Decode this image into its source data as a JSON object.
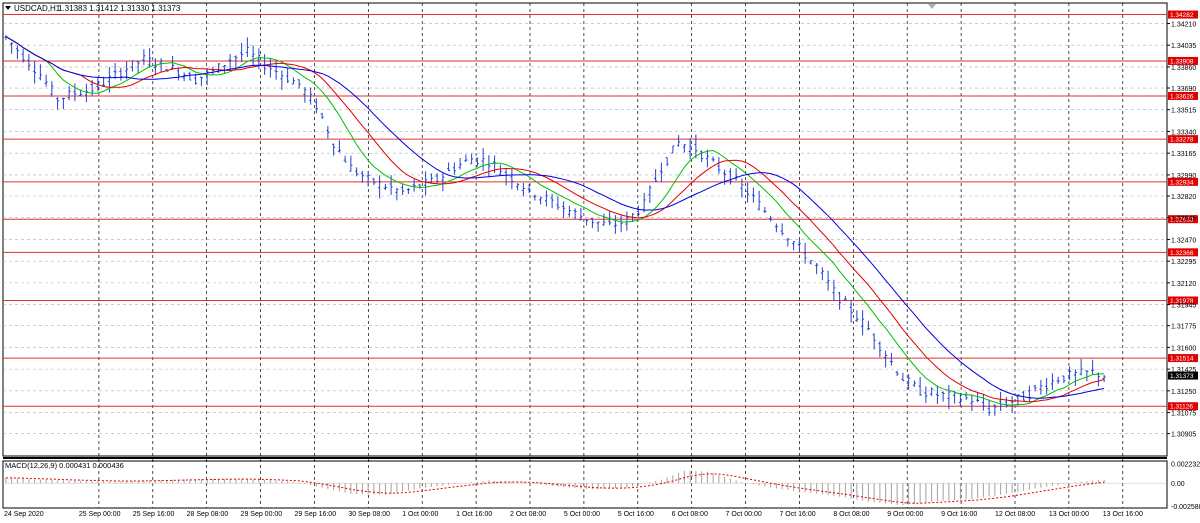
{
  "header": {
    "menu_icon": "triangle-down-icon",
    "symbol": "USDCAD,H1",
    "ohlc": "1.31383 1.31412 1.31330 1.31373"
  },
  "macd_label": "MACD(12,26,9) 0.000431 0.000436",
  "chart_data": [
    {
      "type": "candlestick",
      "title": "USDCAD,H1",
      "ylim": [
        1.30725,
        1.34375
      ],
      "y_ticks": [
        "1.34210",
        "1.34035",
        "1.33860",
        "1.33690",
        "1.33515",
        "1.33340",
        "1.33165",
        "1.32990",
        "1.32820",
        "1.32645",
        "1.32470",
        "1.32295",
        "1.32120",
        "1.31945",
        "1.31775",
        "1.31600",
        "1.31425",
        "1.31250",
        "1.31075",
        "1.30905"
      ],
      "x_ticks": [
        "24 Sep 2020",
        "25 Sep 00:00",
        "25 Sep 16:00",
        "28 Sep 08:00",
        "29 Sep 00:00",
        "29 Sep 16:00",
        "30 Sep 08:00",
        "1 Oct 00:00",
        "1 Oct 16:00",
        "2 Oct 08:00",
        "5 Oct 00:00",
        "5 Oct 16:00",
        "6 Oct 08:00",
        "7 Oct 00:00",
        "7 Oct 16:00",
        "8 Oct 08:00",
        "9 Oct 00:00",
        "9 Oct 16:00",
        "12 Oct 08:00",
        "13 Oct 00:00",
        "13 Oct 16:00"
      ],
      "horizontal_levels": [
        1.34282,
        1.33908,
        1.33626,
        1.33278,
        1.32934,
        1.32633,
        1.32366,
        1.31978,
        1.31514,
        1.31126
      ],
      "current_price": 1.31373,
      "close_path": [
        [
          0,
          1.341
        ],
        [
          3,
          1.3395
        ],
        [
          6,
          1.338
        ],
        [
          9,
          1.336
        ],
        [
          12,
          1.3365
        ],
        [
          15,
          1.3368
        ],
        [
          18,
          1.3376
        ],
        [
          21,
          1.3385
        ],
        [
          24,
          1.3392
        ],
        [
          27,
          1.3388
        ],
        [
          30,
          1.3383
        ],
        [
          33,
          1.3376
        ],
        [
          36,
          1.3382
        ],
        [
          39,
          1.3392
        ],
        [
          42,
          1.3398
        ],
        [
          45,
          1.3388
        ],
        [
          48,
          1.338
        ],
        [
          51,
          1.3372
        ],
        [
          54,
          1.3355
        ],
        [
          57,
          1.3325
        ],
        [
          60,
          1.3305
        ],
        [
          63,
          1.3295
        ],
        [
          66,
          1.329
        ],
        [
          69,
          1.3285
        ],
        [
          72,
          1.329
        ],
        [
          75,
          1.3295
        ],
        [
          78,
          1.3305
        ],
        [
          81,
          1.3312
        ],
        [
          84,
          1.331
        ],
        [
          87,
          1.33
        ],
        [
          90,
          1.329
        ],
        [
          93,
          1.3282
        ],
        [
          96,
          1.3275
        ],
        [
          99,
          1.3268
        ],
        [
          102,
          1.3262
        ],
        [
          105,
          1.3258
        ],
        [
          108,
          1.3262
        ],
        [
          111,
          1.3275
        ],
        [
          114,
          1.3305
        ],
        [
          117,
          1.3325
        ],
        [
          120,
          1.332
        ],
        [
          123,
          1.3308
        ],
        [
          126,
          1.3298
        ],
        [
          129,
          1.3285
        ],
        [
          132,
          1.327
        ],
        [
          135,
          1.3255
        ],
        [
          138,
          1.324
        ],
        [
          141,
          1.3225
        ],
        [
          144,
          1.3205
        ],
        [
          147,
          1.319
        ],
        [
          150,
          1.3175
        ],
        [
          153,
          1.3155
        ],
        [
          156,
          1.3135
        ],
        [
          159,
          1.3125
        ],
        [
          162,
          1.3122
        ],
        [
          165,
          1.312
        ],
        [
          168,
          1.3118
        ],
        [
          171,
          1.311
        ],
        [
          174,
          1.3115
        ],
        [
          177,
          1.312
        ],
        [
          180,
          1.3128
        ],
        [
          183,
          1.3135
        ],
        [
          186,
          1.3138
        ],
        [
          189,
          1.314
        ],
        [
          191,
          1.31373
        ]
      ],
      "moving_averages": [
        {
          "color": "#00c000"
        },
        {
          "color": "#e00000"
        },
        {
          "color": "#0000e0"
        }
      ]
    },
    {
      "type": "histogram",
      "title": "MACD(12,26,9) 0.000431 0.000436",
      "ylim": [
        -0.0028,
        0.0025
      ],
      "y_ticks": [
        "0.002232",
        "0.00",
        "-0.002588"
      ],
      "macd_path": [
        [
          0,
          0.0006
        ],
        [
          10,
          0.0003
        ],
        [
          20,
          0.0002
        ],
        [
          30,
          0.0004
        ],
        [
          40,
          0.0005
        ],
        [
          50,
          0.0002
        ],
        [
          55,
          -0.0005
        ],
        [
          60,
          -0.0012
        ],
        [
          66,
          -0.0013
        ],
        [
          72,
          -0.0006
        ],
        [
          78,
          -0.0001
        ],
        [
          84,
          0.0003
        ],
        [
          90,
          0.0001
        ],
        [
          96,
          -0.0004
        ],
        [
          102,
          -0.0007
        ],
        [
          108,
          -0.0005
        ],
        [
          114,
          0.0004
        ],
        [
          118,
          0.0014
        ],
        [
          122,
          0.0013
        ],
        [
          128,
          0.0001
        ],
        [
          134,
          -0.0006
        ],
        [
          140,
          -0.0011
        ],
        [
          146,
          -0.0016
        ],
        [
          150,
          -0.0021
        ],
        [
          156,
          -0.0025
        ],
        [
          162,
          -0.002
        ],
        [
          168,
          -0.0018
        ],
        [
          174,
          -0.0012
        ],
        [
          180,
          -0.0005
        ],
        [
          186,
          0.0001
        ],
        [
          191,
          0.0004
        ]
      ],
      "signal_color": "#e00000",
      "histogram_color": "#a0a0a0"
    }
  ],
  "colors": {
    "level_line": "#e03030",
    "price_label_bg": "#e00000",
    "current_label_bg": "#000000",
    "candle": "#2040d0",
    "grid": "#b0b0b0"
  }
}
